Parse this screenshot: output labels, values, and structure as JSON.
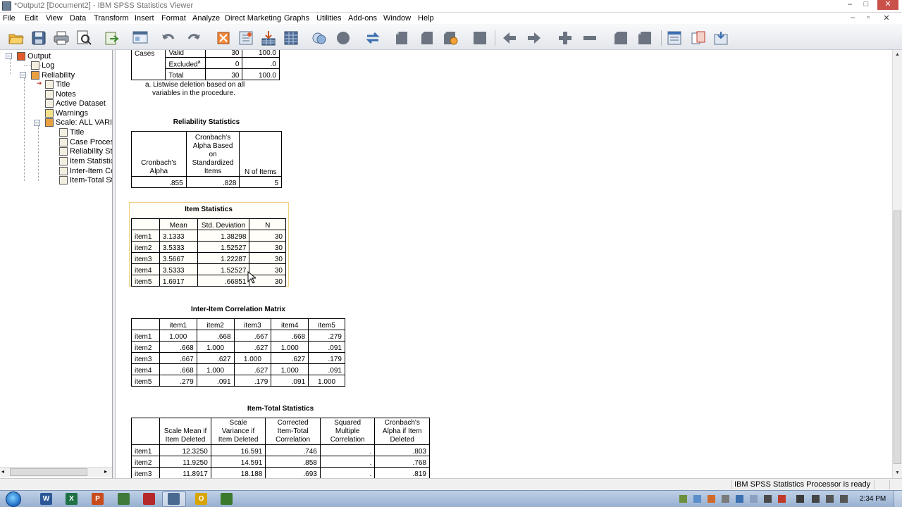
{
  "window": {
    "title": "*Output2 [Document2] - IBM SPSS Statistics Viewer",
    "controls": [
      "–",
      "□",
      "✕"
    ]
  },
  "menu": {
    "items": [
      "File",
      "Edit",
      "View",
      "Data",
      "Transform",
      "Insert",
      "Format",
      "Analyze",
      "Direct Marketing",
      "Graphs",
      "Utilities",
      "Add-ons",
      "Window",
      "Help"
    ]
  },
  "toolbar": {
    "icons": [
      "open-folder-icon",
      "save-icon",
      "print-icon",
      "print-preview-icon",
      "export-icon",
      "recall-dialog-icon",
      "undo-icon",
      "redo-icon",
      "goto-data-icon",
      "goto-case-icon",
      "variables-icon",
      "designate-window-icon",
      "create-chart-icon",
      "spellcheck-icon",
      "select-last-output-icon",
      "insert-heading-icon",
      "insert-title-icon",
      "insert-text-icon",
      "show-all-icon",
      "hide-icon",
      "promote-icon",
      "demote-icon",
      "expand-icon",
      "collapse-icon",
      "show-icon",
      "hide-selected-icon",
      "designated-window-icon",
      "split-icon",
      "merge-icon"
    ]
  },
  "tree": {
    "nodes": [
      "Output",
      "Log",
      "Reliability",
      "Title",
      "Notes",
      "Active Dataset",
      "Warnings",
      "Scale: ALL VARIAB",
      "Title",
      "Case Proces",
      "Reliability Sta",
      "Item Statistics",
      "Inter-Item Co",
      "Item-Total Sta"
    ]
  },
  "case_processing": {
    "rows": [
      {
        "group": "Cases",
        "label": "Valid",
        "n": "30",
        "pct": "100.0"
      },
      {
        "group": "",
        "label": "Excluded",
        "superscript": "a",
        "n": "0",
        "pct": ".0"
      },
      {
        "group": "",
        "label": "Total",
        "n": "30",
        "pct": "100.0"
      }
    ],
    "footnote_line1": "a. Listwise deletion based on all",
    "footnote_line2": "variables in the procedure."
  },
  "reliability": {
    "title": "Reliability Statistics",
    "headers": [
      "Cronbach's Alpha",
      "Cronbach's Alpha Based on Standardized Items",
      "N of Items"
    ],
    "header_lines": {
      "col1": [
        "Cronbach's",
        "Alpha"
      ],
      "col2": [
        "Cronbach's",
        "Alpha Based",
        "on",
        "Standardized",
        "Items"
      ],
      "col3": [
        "N of Items"
      ]
    },
    "values": [
      ".855",
      ".828",
      "5"
    ]
  },
  "item_stats": {
    "title": "Item Statistics",
    "headers": [
      "",
      "Mean",
      "Std. Deviation",
      "N"
    ],
    "rows": [
      [
        "item1",
        "3.1333",
        "1.38298",
        "30"
      ],
      [
        "item2",
        "3.5333",
        "1.52527",
        "30"
      ],
      [
        "item3",
        "3.5667",
        "1.22287",
        "30"
      ],
      [
        "item4",
        "3.5333",
        "1.52527",
        "30"
      ],
      [
        "item5",
        "1.6917",
        ".66851",
        "30"
      ]
    ]
  },
  "corr": {
    "title": "Inter-Item Correlation Matrix",
    "headers": [
      "",
      "item1",
      "item2",
      "item3",
      "item4",
      "item5"
    ],
    "rows": [
      [
        "item1",
        "1.000",
        ".668",
        ".667",
        ".668",
        ".279"
      ],
      [
        "item2",
        ".668",
        "1.000",
        ".627",
        "1.000",
        ".091"
      ],
      [
        "item3",
        ".667",
        ".627",
        "1.000",
        ".627",
        ".179"
      ],
      [
        "item4",
        ".668",
        "1.000",
        ".627",
        "1.000",
        ".091"
      ],
      [
        "item5",
        ".279",
        ".091",
        ".179",
        ".091",
        "1.000"
      ]
    ]
  },
  "item_total": {
    "title": "Item-Total Statistics",
    "header_lines": [
      [],
      [
        "Scale Mean if",
        "Item Deleted"
      ],
      [
        "Scale",
        "Variance if",
        "Item Deleted"
      ],
      [
        "Corrected",
        "Item-Total",
        "Correlation"
      ],
      [
        "Squared",
        "Multiple",
        "Correlation"
      ],
      [
        "Cronbach's",
        "Alpha if Item",
        "Deleted"
      ]
    ],
    "rows": [
      [
        "item1",
        "12.3250",
        "16.591",
        ".746",
        ".",
        ".803"
      ],
      [
        "item2",
        "11.9250",
        "14.591",
        ".858",
        ".",
        ".768"
      ],
      [
        "item3",
        "11.8917",
        "18.188",
        ".693",
        ".",
        ".819"
      ]
    ]
  },
  "status": {
    "message": "IBM SPSS Statistics Processor is ready"
  },
  "taskbar": {
    "apps": [
      "W",
      "X",
      "P",
      "",
      "",
      "",
      "O",
      ""
    ],
    "clock": "2:34 PM"
  },
  "colors": {
    "selection_border": "#f0d080",
    "toolbar_top": "#f7f8fa",
    "toolbar_bottom": "#e3e6eb"
  }
}
